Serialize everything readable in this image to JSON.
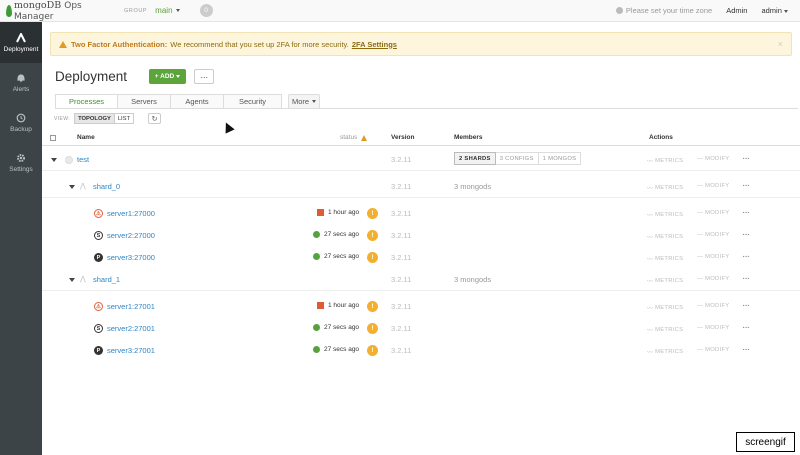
{
  "topbar": {
    "logo_mongo": "mongoDB",
    "logo_product": "Ops Manager",
    "group_label": "GROUP",
    "group_value": "main",
    "alert_count": "0",
    "timezone_notice": "Please set your time zone",
    "admin_link": "Admin",
    "user_menu": "admin"
  },
  "sidebar": {
    "items": [
      {
        "label": "Deployment",
        "icon": "deployment-icon",
        "active": true
      },
      {
        "label": "Alerts",
        "icon": "bell-icon",
        "active": false
      },
      {
        "label": "Backup",
        "icon": "backup-icon",
        "active": false
      },
      {
        "label": "Settings",
        "icon": "gear-icon",
        "active": false
      }
    ]
  },
  "banner": {
    "title": "Two Factor Authentication:",
    "message": "We recommend that you set up 2FA for more security.",
    "link": "2FA Settings",
    "close": "×"
  },
  "page": {
    "title": "Deployment",
    "add_label": "+ ADD",
    "more_label": "···"
  },
  "tabs": [
    {
      "label": "Processes",
      "active": true
    },
    {
      "label": "Servers",
      "active": false
    },
    {
      "label": "Agents",
      "active": false
    },
    {
      "label": "Security",
      "active": false
    }
  ],
  "tabs_more": "More",
  "view": {
    "label": "VIEW:",
    "options": [
      "TOPOLOGY",
      "LIST"
    ],
    "selected": "TOPOLOGY",
    "refresh": "↻"
  },
  "table": {
    "headers": {
      "name": "Name",
      "status": "status",
      "version": "Version",
      "members": "Members",
      "actions": "Actions"
    },
    "action_labels": {
      "metrics": "METRICS",
      "modify": "MODIFY",
      "more": "···"
    },
    "cluster": {
      "name": "test",
      "version": "3.2.11",
      "member_buttons": [
        "2 SHARDS",
        "3 CONFIGS",
        "1 MONGOS"
      ]
    },
    "shards": [
      {
        "name": "shard_0",
        "version": "3.2.11",
        "members": "3 mongods",
        "servers": [
          {
            "role": "down",
            "letter": "⚠",
            "name": "server1:27000",
            "status_type": "down",
            "status": "1 hour ago",
            "badge": "!",
            "version": "3.2.11"
          },
          {
            "role": "secondary",
            "letter": "S",
            "name": "server2:27000",
            "status_type": "ok",
            "status": "27 secs ago",
            "badge": "!",
            "version": "3.2.11"
          },
          {
            "role": "primary",
            "letter": "P",
            "name": "server3:27000",
            "status_type": "ok",
            "status": "27 secs ago",
            "badge": "!",
            "version": "3.2.11"
          }
        ]
      },
      {
        "name": "shard_1",
        "version": "3.2.11",
        "members": "3 mongods",
        "servers": [
          {
            "role": "down",
            "letter": "⚠",
            "name": "server1:27001",
            "status_type": "down",
            "status": "1 hour ago",
            "badge": "!",
            "version": "3.2.11"
          },
          {
            "role": "secondary",
            "letter": "S",
            "name": "server2:27001",
            "status_type": "ok",
            "status": "27 secs ago",
            "badge": "!",
            "version": "3.2.11"
          },
          {
            "role": "primary",
            "letter": "P",
            "name": "server3:27001",
            "status_type": "ok",
            "status": "27 secs ago",
            "badge": "!",
            "version": "3.2.11"
          }
        ]
      }
    ]
  },
  "watermark": "screengif",
  "colors": {
    "accent_green": "#5ba53b",
    "link_blue": "#2f86c4",
    "warning": "#f2b02e",
    "error": "#e05a36",
    "sidebar": "#3d4448"
  }
}
